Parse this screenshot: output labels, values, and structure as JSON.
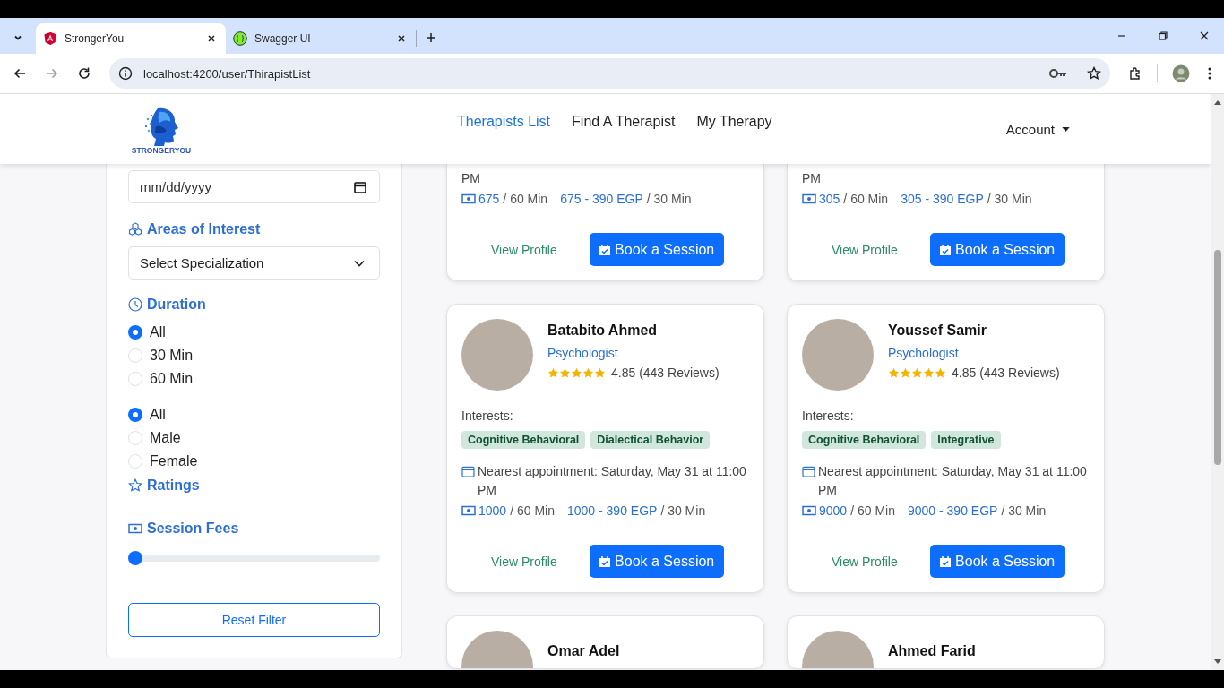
{
  "browser": {
    "tabs": [
      {
        "title": "StrongerYou",
        "selected": true,
        "kind": "angular"
      },
      {
        "title": "Swagger UI",
        "selected": false,
        "kind": "swagger"
      }
    ],
    "url": "localhost:4200/user/ThirapistList"
  },
  "header": {
    "logo_text": "STRONGERYOU",
    "nav": [
      {
        "label": "Therapists List",
        "selected": true
      },
      {
        "label": "Find A Therapist",
        "selected": false
      },
      {
        "label": "My Therapy",
        "selected": false
      }
    ],
    "account": "Account"
  },
  "filters": {
    "date_placeholder": "mm/dd/yyyy",
    "areas_title": "Areas of Interest",
    "specialization": "Select Specialization",
    "duration_title": "Duration",
    "duration_options": [
      {
        "label": "All",
        "selected": true
      },
      {
        "label": "30 Min",
        "selected": false
      },
      {
        "label": "60 Min",
        "selected": false
      }
    ],
    "gender_options": [
      {
        "label": "All",
        "selected": true
      },
      {
        "label": "Male",
        "selected": false
      },
      {
        "label": "Female",
        "selected": false
      }
    ],
    "ratings_title": "Ratings",
    "fees_title": "Session Fees",
    "fees_slider": {
      "level": 0
    },
    "reset": "Reset Filter"
  },
  "partial_cards": [
    {
      "appointment_tail": "PM",
      "price_60": "675",
      "unit_60": "/ 60 Min",
      "price_30": "675 - 390 EGP",
      "unit_30": "/ 30 Min",
      "view": "View Profile",
      "book": "Book a Session"
    },
    {
      "appointment_tail": "PM",
      "price_60": "305",
      "unit_60": "/ 60 Min",
      "price_30": "305 - 390 EGP",
      "unit_30": "/ 30 Min",
      "view": "View Profile",
      "book": "Book a Session"
    }
  ],
  "cards": [
    {
      "name": "Batabito Ahmed",
      "title": "Psychologist",
      "stars": 5,
      "rating": "4.85 (443 Reviews)",
      "interests_label": "Interests:",
      "interests": [
        "Cognitive Behavioral",
        "Dialectical Behavior"
      ],
      "appointment": "Nearest appointment: Saturday, May 31 at 11:00 PM",
      "price_60": "1000",
      "unit_60": "/ 60 Min",
      "price_30": "1000 - 390 EGP",
      "unit_30": "/ 30 Min",
      "view": "View Profile",
      "book": "Book a Session"
    },
    {
      "name": "Youssef Samir",
      "title": "Psychologist",
      "stars": 5,
      "rating": "4.85 (443 Reviews)",
      "interests_label": "Interests:",
      "interests": [
        "Cognitive Behavioral",
        "Integrative"
      ],
      "appointment": "Nearest appointment: Saturday, May 31 at 11:00 PM",
      "price_60": "9000",
      "unit_60": "/ 60 Min",
      "price_30": "9000 - 390 EGP",
      "unit_30": "/ 30 Min",
      "view": "View Profile",
      "book": "Book a Session"
    }
  ],
  "next_cards": [
    {
      "name": "Omar Adel"
    },
    {
      "name": "Ahmed Farid"
    }
  ]
}
